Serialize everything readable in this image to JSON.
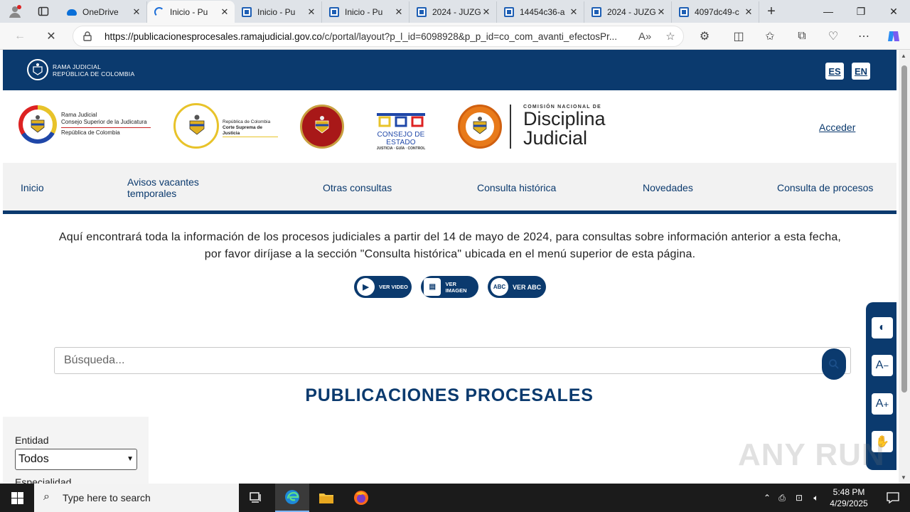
{
  "browser": {
    "tabs": [
      {
        "label": "OneDrive",
        "icon": "onedrive-icon",
        "active": false
      },
      {
        "label": "Inicio - Pu",
        "icon": "loading-spinner-icon",
        "active": true
      },
      {
        "label": "Inicio - Pu",
        "icon": "site-favicon-icon",
        "active": false
      },
      {
        "label": "Inicio - Pu",
        "icon": "site-favicon-icon",
        "active": false
      },
      {
        "label": "2024 - JUZG",
        "icon": "site-favicon-icon",
        "active": false
      },
      {
        "label": "14454c36-a",
        "icon": "site-favicon-icon",
        "active": false
      },
      {
        "label": "2024 - JUZG",
        "icon": "site-favicon-icon",
        "active": false
      },
      {
        "label": "4097dc49-c",
        "icon": "site-favicon-icon",
        "active": false
      }
    ],
    "url_host": "https://publicacionesprocesales.ramajudicial.gov.co",
    "url_path": "/c/portal/layout?p_l_id=6098928&p_p_id=co_com_avanti_efectosPr..."
  },
  "page": {
    "banner": {
      "org_line1": "Rama Judicial",
      "org_line2": "República de Colombia",
      "lang_es": "ES",
      "lang_en": "EN"
    },
    "logos": {
      "csj_line1": "Rama Judicial",
      "csj_line2": "Consejo Superior de la Judicatura",
      "csj_line3": "República de Colombia",
      "csj_line4": "República de Colombia",
      "csj_line5": "Corte Suprema de Justicia",
      "consejo_estado": "CONSEJO DE ESTADO",
      "consejo_estado_sub": "JUSTICIA · GUÍA · CONTROL",
      "comision_small": "COMISIÓN NACIONAL DE",
      "disciplina_1": "Disciplina",
      "disciplina_2": "Judicial"
    },
    "acceder": "Acceder",
    "menu": [
      "Inicio",
      "Avisos vacantes\ntemporales",
      "Otras consultas",
      "Consulta histórica",
      "Novedades",
      "Consulta de procesos"
    ],
    "intro_line1": "Aquí encontrará toda la información de los procesos judiciales a partir del 14 de mayo de 2024, para consultas sobre información anterior a esta fecha,",
    "intro_line2": "por favor diríjase a la sección \"Consulta histórica\" ubicada en el menú superior de esta página.",
    "pill_video": "VER VIDEO",
    "pill_imagen": "VER IMAGEN",
    "pill_abc_badge": "ABC",
    "pill_abc": "VER ABC",
    "search_placeholder": "Búsqueda...",
    "title": "PUBLICACIONES PROCESALES",
    "filter_entidad_label": "Entidad",
    "filter_entidad_value": "Todos",
    "filter_next_label": "Especialidad",
    "a11y_buttons": [
      "contrast-icon",
      "decrease-font-icon",
      "increase-font-icon",
      "sign-language-icon"
    ],
    "a11y_decrease": "A",
    "a11y_increase": "A"
  },
  "watermark": "ANY RUN",
  "taskbar": {
    "search_placeholder": "Type here to search",
    "time": "5:48 PM",
    "date": "4/29/2025"
  },
  "colors": {
    "brand_navy": "#0b3a6e",
    "menu_bg": "#f2f2f2"
  }
}
